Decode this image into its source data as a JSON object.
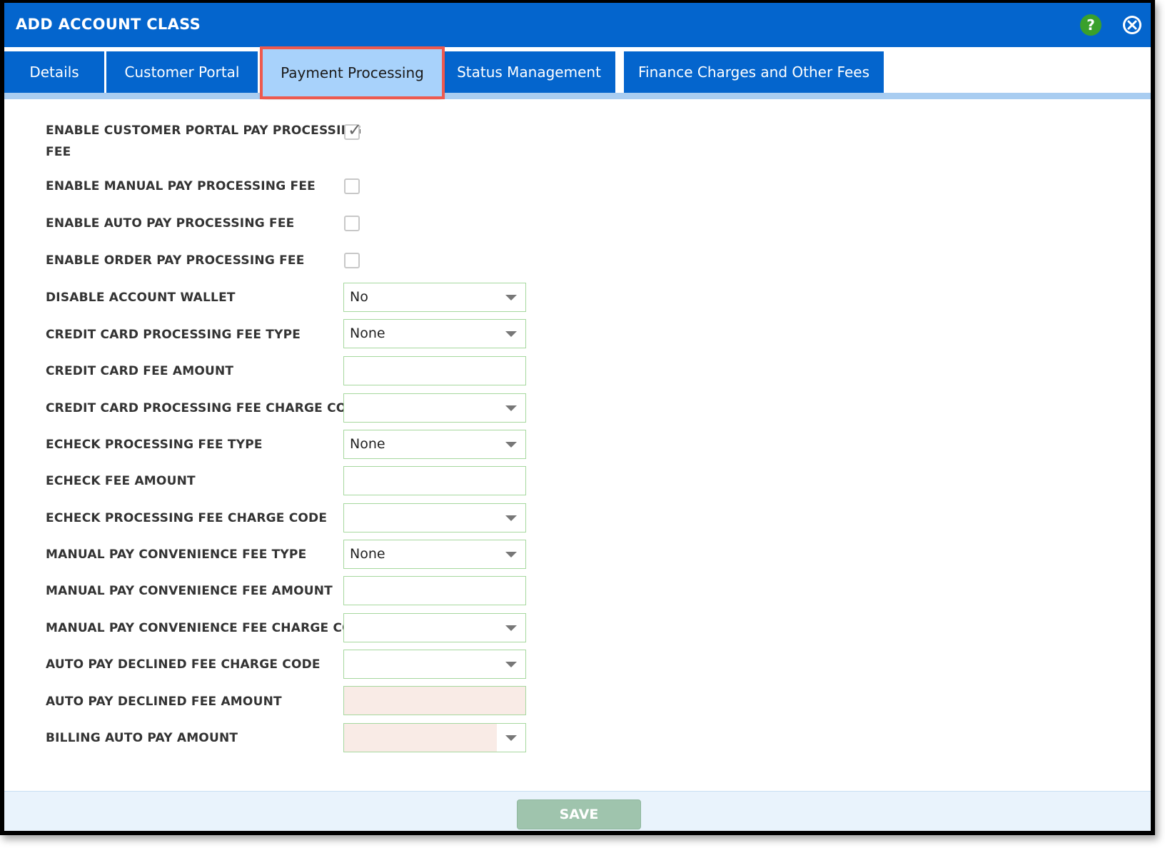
{
  "dialog": {
    "title": "ADD ACCOUNT CLASS",
    "help_icon_glyph": "?"
  },
  "tabs": [
    {
      "label": "Details",
      "active": false
    },
    {
      "label": "Customer Portal",
      "active": false
    },
    {
      "label": "Payment Processing",
      "active": true
    },
    {
      "label": "Status Management",
      "active": false
    },
    {
      "label": "Finance Charges and Other Fees",
      "active": false
    }
  ],
  "form": {
    "enable_customer_portal_fee": {
      "label_line1": "ENABLE CUSTOMER PORTAL PAY PROCESSING",
      "label_line2": "FEE",
      "checked": true
    },
    "enable_manual_fee": {
      "label": "ENABLE MANUAL PAY PROCESSING FEE",
      "checked": false
    },
    "enable_auto_fee": {
      "label": "ENABLE AUTO PAY PROCESSING FEE",
      "checked": false
    },
    "enable_order_fee": {
      "label": "ENABLE ORDER PAY PROCESSING FEE",
      "checked": false
    },
    "disable_wallet": {
      "label": "DISABLE ACCOUNT WALLET",
      "value": "No"
    },
    "cc_fee_type": {
      "label": "CREDIT CARD PROCESSING FEE TYPE",
      "value": "None"
    },
    "cc_fee_amount": {
      "label": "CREDIT CARD FEE AMOUNT",
      "value": ""
    },
    "cc_fee_charge_code": {
      "label": "CREDIT CARD PROCESSING FEE CHARGE CODE",
      "value": ""
    },
    "echeck_fee_type": {
      "label": "ECHECK PROCESSING FEE TYPE",
      "value": "None"
    },
    "echeck_fee_amount": {
      "label": "ECHECK FEE AMOUNT",
      "value": ""
    },
    "echeck_fee_charge_code": {
      "label": "ECHECK PROCESSING FEE CHARGE CODE",
      "value": ""
    },
    "manual_conv_fee_type": {
      "label": "MANUAL PAY CONVENIENCE FEE TYPE",
      "value": "None"
    },
    "manual_conv_fee_amount": {
      "label": "MANUAL PAY CONVENIENCE FEE AMOUNT",
      "value": ""
    },
    "manual_conv_fee_charge_code": {
      "label": "MANUAL PAY CONVENIENCE FEE CHARGE CODE",
      "value": ""
    },
    "auto_declined_charge_code": {
      "label": "AUTO PAY DECLINED FEE CHARGE CODE",
      "value": ""
    },
    "auto_declined_amount": {
      "label": "AUTO PAY DECLINED FEE AMOUNT",
      "value": ""
    },
    "billing_auto_pay_amount": {
      "label": "BILLING AUTO PAY AMOUNT",
      "value": ""
    }
  },
  "footer": {
    "save_label": "SAVE"
  },
  "colors": {
    "header_blue": "#0465cd",
    "active_tab": "#a8d2fb",
    "highlight_outline": "#ed5a4f",
    "field_border": "#a6d89e",
    "readonly_field": "#f9ebe6",
    "save_button": "#9fc4ad"
  }
}
